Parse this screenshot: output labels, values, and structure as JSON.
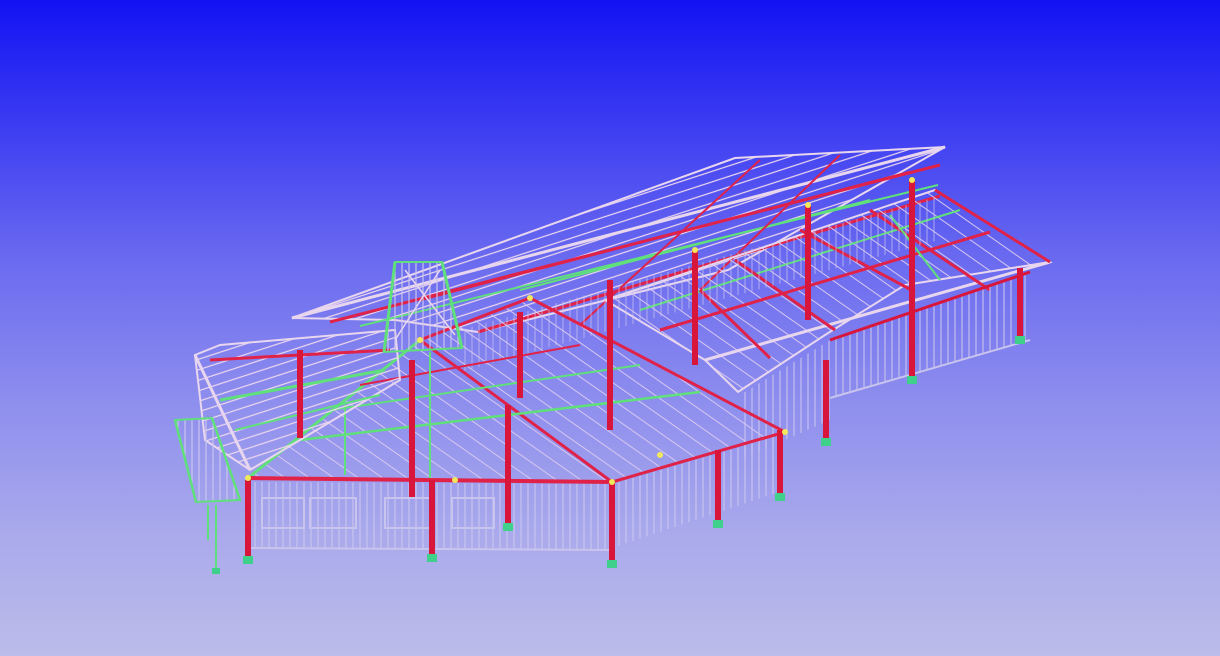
{
  "viewport": {
    "kind": "3d-model-viewer",
    "background_top": "#1212f4",
    "background_bottom": "#bcbcea"
  },
  "model": {
    "subject": "steel-frame-building",
    "view": "isometric-wireframe",
    "colors": {
      "columns": "#d8153a",
      "beams": "#e02248",
      "bracing": "#5fe07a",
      "purlins": "#e6d2e6",
      "studs": "#c9c4ee",
      "joints": "#f2e85a",
      "base_plates": "#3fd08c"
    }
  }
}
